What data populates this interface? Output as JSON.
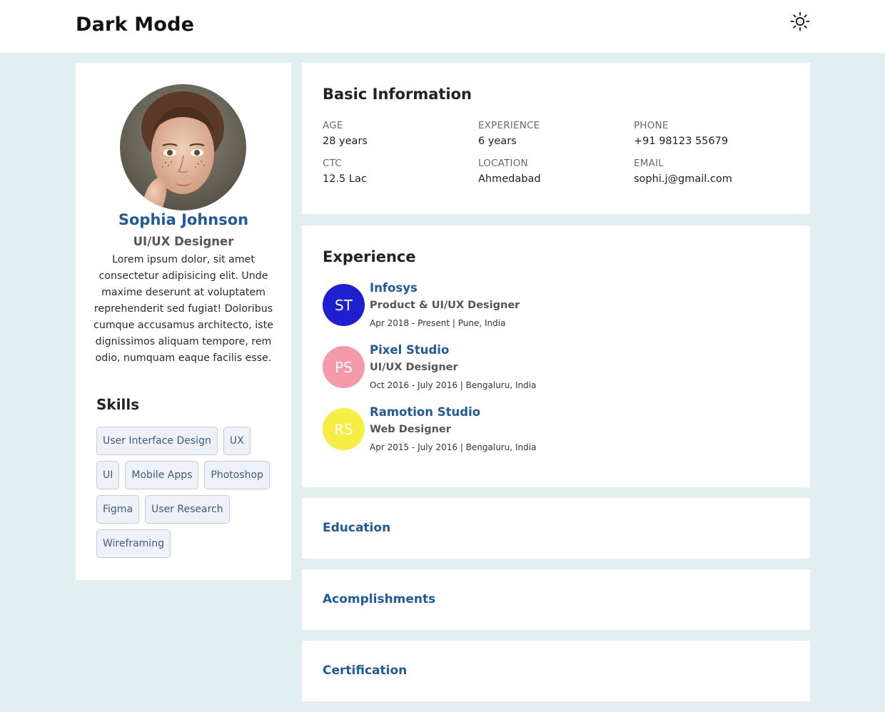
{
  "header": {
    "brand": "Dark Mode",
    "theme_icon": "sun-icon"
  },
  "profile": {
    "name": "Sophia Johnson",
    "role": "UI/UX Designer",
    "bio": "Lorem ipsum dolor, sit amet consectetur adipisicing elit. Unde maxime deserunt at voluptatem reprehenderit sed fugiat! Doloribus cumque accusamus architecto, iste dignissimos aliquam tempore, rem odio, numquam eaque facilis esse.",
    "skills_title": "Skills",
    "skills": [
      "User Interface Design",
      "UX",
      "UI",
      "Mobile Apps",
      "Photoshop",
      "Figma",
      "User Research",
      "Wireframing"
    ]
  },
  "basic_info": {
    "title": "Basic Information",
    "fields": [
      {
        "label": "AGE",
        "value": "28 years"
      },
      {
        "label": "EXPERIENCE",
        "value": "6 years"
      },
      {
        "label": "PHONE",
        "value": "+91 98123 55679"
      },
      {
        "label": "CTC",
        "value": "12.5 Lac"
      },
      {
        "label": "LOCATION",
        "value": "Ahmedabad"
      },
      {
        "label": "EMAIL",
        "value": "sophi.j@gmail.com"
      }
    ]
  },
  "experience": {
    "title": "Experience",
    "items": [
      {
        "initials": "ST",
        "color": "#1d1fd1",
        "company": "Infosys",
        "role": "Product & UI/UX Designer",
        "meta": "Apr 2018 - Present | Pune, India"
      },
      {
        "initials": "PS",
        "color": "#f59aaa",
        "company": "Pixel Studio",
        "role": "UI/UX Designer",
        "meta": "Oct 2016 - July 2016 | Bengaluru, India"
      },
      {
        "initials": "RS",
        "color": "#f7ee43",
        "company": "Ramotion Studio",
        "role": "Web Designer",
        "meta": "Apr 2015 - July 2016 | Bengaluru, India"
      }
    ]
  },
  "sections": {
    "education": "Education",
    "accomplishments": "Acomplishments",
    "certification": "Certification"
  },
  "colors": {
    "accent": "#1f5a9e",
    "background": "#e1eff0"
  }
}
